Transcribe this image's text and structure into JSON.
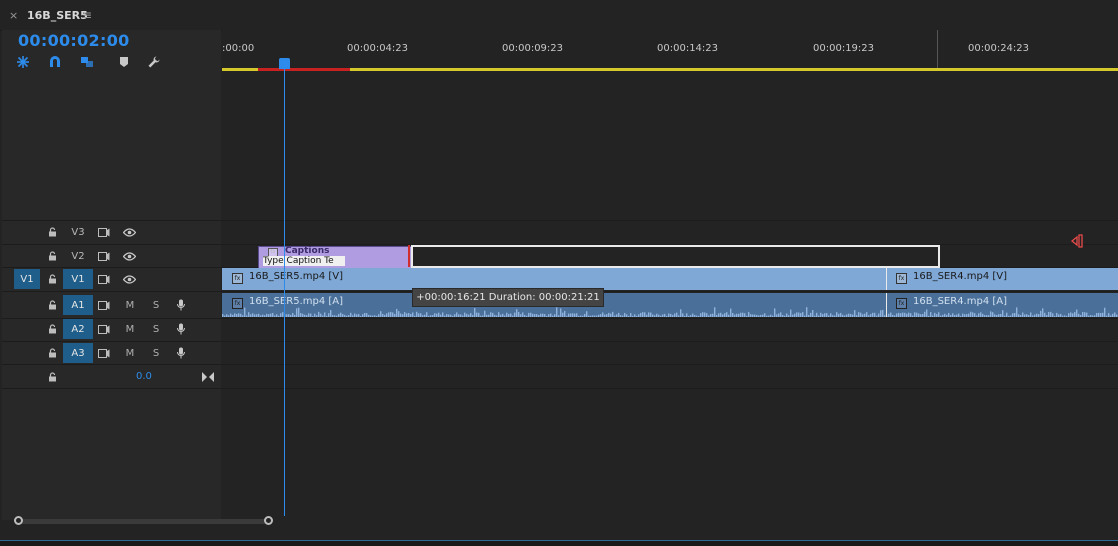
{
  "sequence": {
    "tab_title": "16B_SER5",
    "close_glyph": "×",
    "menu_glyph": "≡",
    "timecode": "00:00:02:00"
  },
  "ruler": {
    "ticks": [
      ":00:00",
      "00:00:04:23",
      "00:00:09:23",
      "00:00:14:23",
      "00:00:19:23",
      "00:00:24:23"
    ]
  },
  "tracks": {
    "video": [
      {
        "name": "V3",
        "source": "",
        "targeted": false
      },
      {
        "name": "V2",
        "source": "",
        "targeted": false
      },
      {
        "name": "V1",
        "source": "V1",
        "targeted": true
      }
    ],
    "audio": [
      {
        "name": "A1",
        "mute": "M",
        "solo": "S",
        "targeted": true
      },
      {
        "name": "A2",
        "mute": "M",
        "solo": "S",
        "targeted": true
      },
      {
        "name": "A3",
        "mute": "M",
        "solo": "S",
        "targeted": true
      }
    ],
    "master_volume": "0.0"
  },
  "clips": {
    "caption_title": "Captions",
    "caption_text": "Type Caption Te",
    "video_clip_1": "16B_SER5.mp4 [V]",
    "video_clip_2": "16B_SER4.mp4 [V]",
    "audio_clip_1": "16B_SER5.mp4 [A]",
    "audio_clip_2": "16B_SER4.mp4 [A]",
    "fx_badge": "fx"
  },
  "tooltip": "+00:00:16:21 Duration: 00:00:21:21",
  "colors": {
    "accent": "#2d8ceb",
    "video_clip": "#7fa8d6",
    "audio_clip": "#4a6f98",
    "caption_clip": "#b09ce0",
    "work_area": "#d4c82a",
    "in_out": "#c72121"
  }
}
